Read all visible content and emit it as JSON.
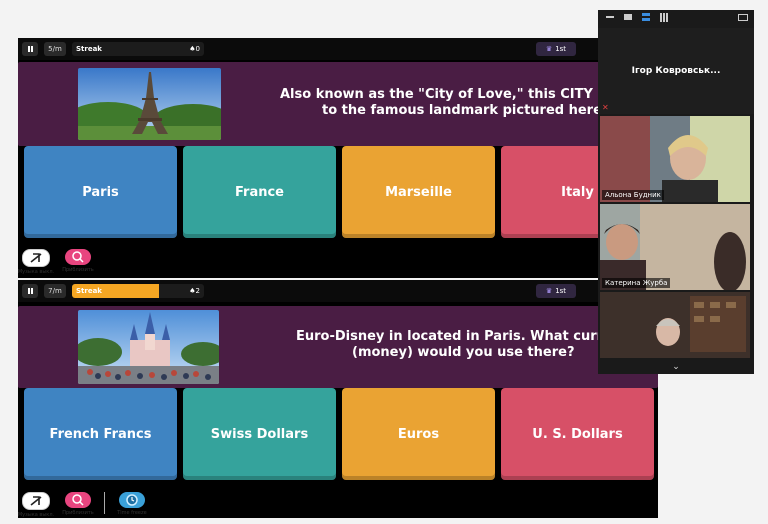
{
  "quiz1": {
    "question_counter": "5/m",
    "streak_label": "Streak",
    "streak_count": "♠0",
    "streak_fill": 0,
    "rank": "1st",
    "question_line1": "Also known as the \"City of Love,\" this CITY is",
    "question_line2": "to the famous landmark pictured here.",
    "image_subject": "eiffel-tower",
    "answers": [
      {
        "label": "Paris",
        "color": "#3f84c2"
      },
      {
        "label": "France",
        "color": "#35a39c"
      },
      {
        "label": "Marseille",
        "color": "#eaa333"
      },
      {
        "label": "Italy",
        "color": "#d75067"
      }
    ]
  },
  "quiz2": {
    "question_counter": "7/m",
    "streak_label": "Streak",
    "streak_count": "♠2",
    "streak_fill": 0.66,
    "rank": "1st",
    "question_line1": "Euro-Disney in located in Paris. What curre",
    "question_line2": "(money) would you use there?",
    "image_subject": "disney-castle",
    "answers": [
      {
        "label": "French Francs",
        "color": "#3f84c2"
      },
      {
        "label": "Swiss Dollars",
        "color": "#35a39c"
      },
      {
        "label": "Euros",
        "color": "#eaa333"
      },
      {
        "label": "U. S. Dollars",
        "color": "#d75067"
      }
    ]
  },
  "tools1": [
    {
      "label": "Музыка выкл.",
      "icon": "music-off-icon"
    },
    {
      "label": "Приблизить",
      "icon": "zoom-icon"
    }
  ],
  "tools2": [
    {
      "label": "Музыка выкл.",
      "icon": "music-off-icon"
    },
    {
      "label": "Приблизить",
      "icon": "zoom-icon"
    },
    {
      "label": "Time freeze",
      "icon": "time-freeze-icon"
    }
  ],
  "video": {
    "host_name": "Ігор  Ковровськ...",
    "participants": [
      {
        "name": "Альона Будник"
      },
      {
        "name": "Катерина Журба"
      },
      {
        "name": ""
      }
    ]
  },
  "colors": {
    "panel": "#4a1d44",
    "accent": "#f5a623"
  }
}
